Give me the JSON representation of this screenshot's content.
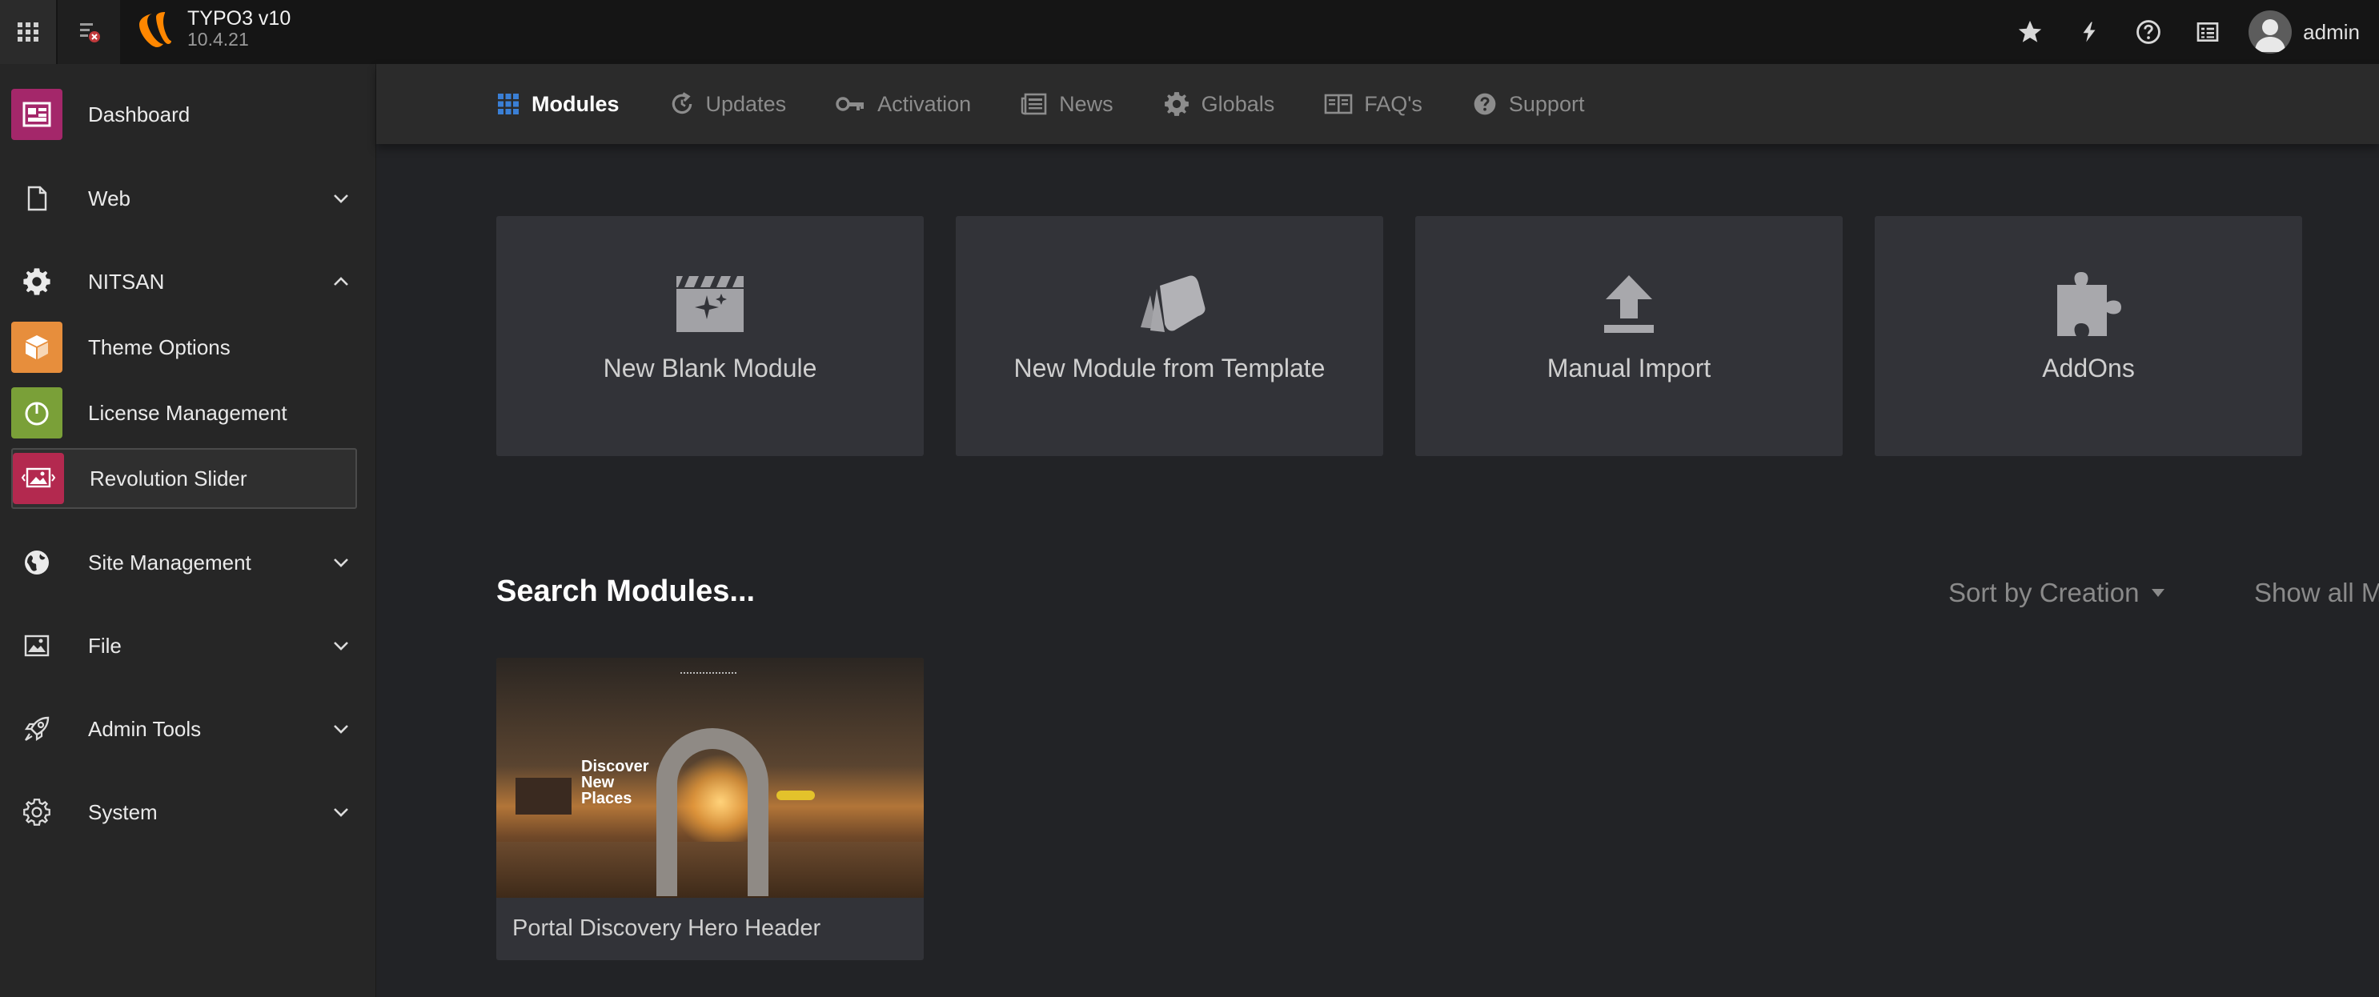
{
  "app": {
    "title": "TYPO3 v10",
    "version": "10.4.21",
    "brand_color": "#ff8700"
  },
  "topbar": {
    "icons": [
      "star-icon",
      "bolt-icon",
      "help-icon",
      "list-icon"
    ],
    "user": "admin"
  },
  "sidebar": {
    "items": [
      {
        "label": "Dashboard",
        "icon": "dashboard-icon",
        "color": "#a4276a"
      },
      {
        "label": "Web",
        "icon": "page-icon"
      },
      {
        "label": "NITSAN",
        "icon": "gear-icon"
      },
      {
        "label": "Theme Options",
        "icon": "box-icon",
        "color": "#e78e3c"
      },
      {
        "label": "License Management",
        "icon": "power-icon",
        "color": "#7aa038"
      },
      {
        "label": "Revolution Slider",
        "icon": "image-slider-icon",
        "color": "#b3294f"
      },
      {
        "label": "Site Management",
        "icon": "globe-icon"
      },
      {
        "label": "File",
        "icon": "image-icon"
      },
      {
        "label": "Admin Tools",
        "icon": "rocket-icon"
      },
      {
        "label": "System",
        "icon": "cog-icon"
      }
    ]
  },
  "tabs": [
    {
      "label": "Modules",
      "icon": "grid-icon",
      "active": true
    },
    {
      "label": "Updates",
      "icon": "refresh-icon"
    },
    {
      "label": "Activation",
      "icon": "key-icon"
    },
    {
      "label": "News",
      "icon": "newspaper-icon"
    },
    {
      "label": "Globals",
      "icon": "gear-icon"
    },
    {
      "label": "FAQ's",
      "icon": "book-icon"
    },
    {
      "label": "Support",
      "icon": "question-icon"
    }
  ],
  "cards": [
    {
      "label": "New Blank Module",
      "icon": "clapperboard-sparkle-icon"
    },
    {
      "label": "New Module from Template",
      "icon": "template-cards-icon"
    },
    {
      "label": "Manual Import",
      "icon": "upload-icon"
    },
    {
      "label": "AddOns",
      "icon": "puzzle-icon"
    }
  ],
  "search": {
    "title": "Search Modules...",
    "sort_label": "Sort by Creation",
    "show_all": "Show all M"
  },
  "modules": [
    {
      "name": "Portal Discovery Hero Header",
      "thumbnail_text": "Discover New Places"
    }
  ]
}
